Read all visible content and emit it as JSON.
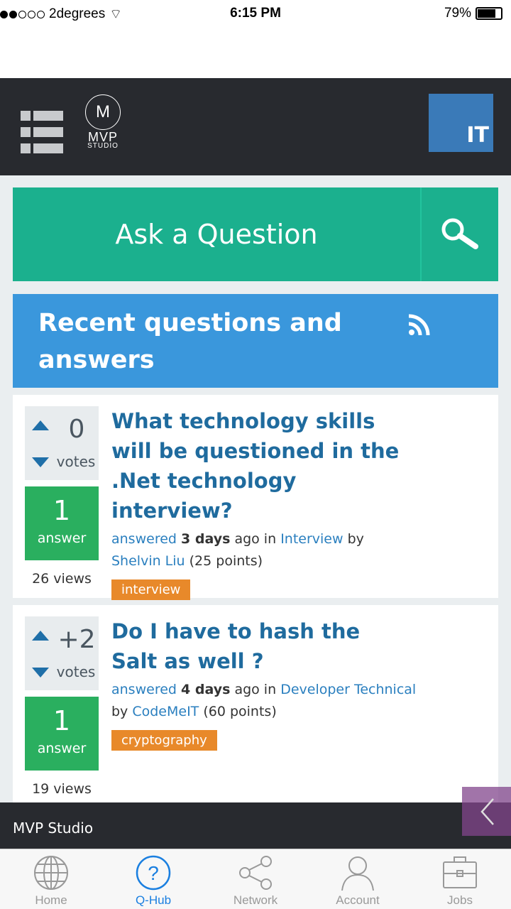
{
  "status": {
    "carrier": "2degrees",
    "time": "6:15 PM",
    "battery": "79%",
    "signal_bars": 2,
    "battery_level": 0.79
  },
  "header": {
    "logo_line1": "MVP",
    "logo_line2": "STUDIO",
    "avatar_text": "IT"
  },
  "ask": {
    "label": "Ask a Question"
  },
  "banner": {
    "title": "Recent questions and answers"
  },
  "questions": [
    {
      "votes": "0",
      "votes_label": "votes",
      "answers": "1",
      "answers_label": "answer",
      "views": "26 views",
      "title": "What technology skills will be questioned in the .Net technology interview?",
      "status": "answered",
      "when": "3 days",
      "ago": "ago in",
      "category": "Interview",
      "by": "by",
      "user": "Shelvin Liu",
      "points": "(25 points)",
      "tag": "interview"
    },
    {
      "votes": "+2",
      "votes_label": "votes",
      "answers": "1",
      "answers_label": "answer",
      "views": "19 views",
      "title": "Do I have to hash the Salt as well ?",
      "status": "answered",
      "when": "4 days",
      "ago": "ago in",
      "category": "Developer Technical",
      "by": "by",
      "user": "CodeMeIT",
      "points": "(60 points)",
      "tag": "cryptography"
    }
  ],
  "footer": {
    "title": "MVP Studio"
  },
  "tabs": [
    {
      "label": "Home",
      "icon": "globe"
    },
    {
      "label": "Q-Hub",
      "icon": "question",
      "active": true
    },
    {
      "label": "Network",
      "icon": "share"
    },
    {
      "label": "Account",
      "icon": "person"
    },
    {
      "label": "Jobs",
      "icon": "briefcase"
    }
  ],
  "colors": {
    "teal": "#1bb08e",
    "blue": "#3a97dc",
    "green": "#2aaf5f",
    "orange": "#e8892a",
    "active": "#1a7fe0"
  }
}
